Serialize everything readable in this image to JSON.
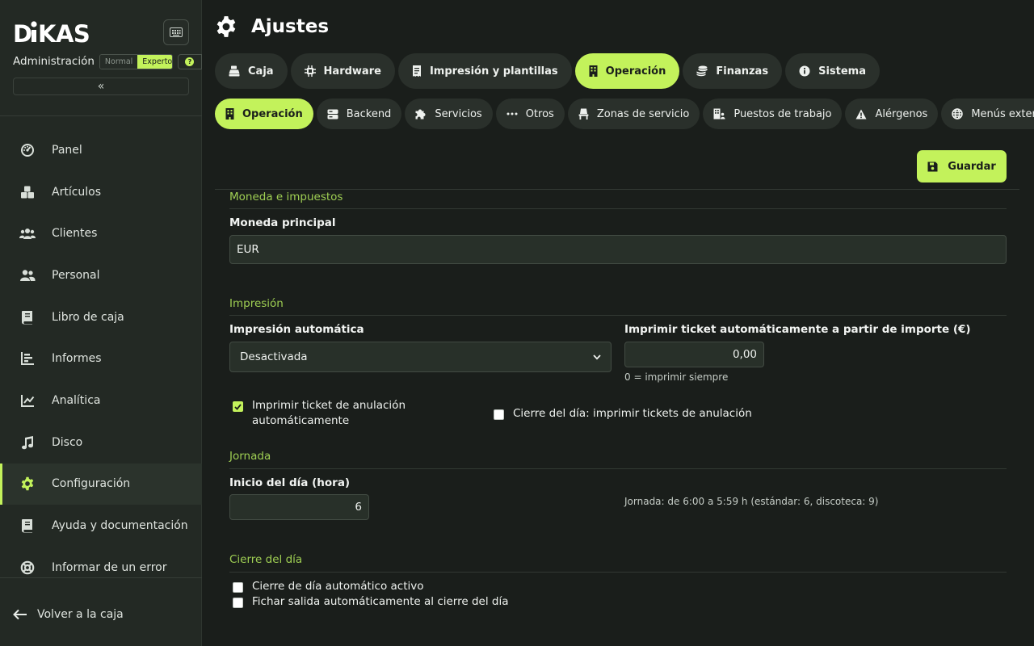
{
  "brand": {
    "logo": "DIKAS"
  },
  "sidebar": {
    "admin_label": "Administración",
    "modes": {
      "normal": "Normal",
      "expert": "Experto",
      "selected": "Experto"
    },
    "help_badge": "?",
    "collapse_glyph": "«",
    "items": [
      {
        "label": "Panel",
        "icon": "dashboard-icon"
      },
      {
        "label": "Artículos",
        "icon": "boxes-icon"
      },
      {
        "label": "Clientes",
        "icon": "users-icon"
      },
      {
        "label": "Personal",
        "icon": "user-group-icon"
      },
      {
        "label": "Libro de caja",
        "icon": "book-icon"
      },
      {
        "label": "Informes",
        "icon": "bar-chart-icon"
      },
      {
        "label": "Analítica",
        "icon": "line-chart-icon"
      },
      {
        "label": "Disco",
        "icon": "music-icon"
      },
      {
        "label": "Configuración",
        "icon": "gear-icon",
        "active": true
      },
      {
        "label": "Ayuda y documentación",
        "icon": "book-icon"
      },
      {
        "label": "Informar de un error",
        "icon": "lifebuoy-icon"
      }
    ],
    "back_label": "Volver a la caja"
  },
  "header": {
    "title": "Ajustes"
  },
  "tabs": [
    {
      "label": "Caja",
      "icon": "register-icon"
    },
    {
      "label": "Hardware",
      "icon": "chip-icon"
    },
    {
      "label": "Impresión y plantillas",
      "icon": "receipt-icon"
    },
    {
      "label": "Operación",
      "icon": "building-icon",
      "active": true
    },
    {
      "label": "Finanzas",
      "icon": "coins-icon"
    },
    {
      "label": "Sistema",
      "icon": "info-icon"
    }
  ],
  "subtabs": [
    {
      "label": "Operación",
      "icon": "building-icon",
      "active": true
    },
    {
      "label": "Backend",
      "icon": "server-icon"
    },
    {
      "label": "Servicios",
      "icon": "puzzle-icon"
    },
    {
      "label": "Otros",
      "icon": "ellipsis-icon"
    },
    {
      "label": "Zonas de servicio",
      "icon": "chair-icon"
    },
    {
      "label": "Puestos de trabajo",
      "icon": "building-user-icon"
    },
    {
      "label": "Alérgenos",
      "icon": "warning-icon"
    },
    {
      "label": "Menús externos",
      "icon": "globe-icon"
    }
  ],
  "actions": {
    "save_label": "Guardar"
  },
  "sections": {
    "currency": {
      "title": "Moneda e impuestos",
      "main_currency_label": "Moneda principal",
      "main_currency_value": "EUR"
    },
    "printing": {
      "title": "Impresión",
      "auto_print_label": "Impresión automática",
      "auto_print_value": "Desactivada",
      "threshold_label": "Imprimir ticket automáticamente a partir de importe (€)",
      "threshold_value": "0,00",
      "threshold_hint": "0 = imprimir siempre",
      "cancel_ticket_label": "Imprimir ticket de anulación automáticamente",
      "cancel_ticket_checked": true,
      "close_day_cancel_label": "Cierre del día: imprimir tickets de anulación",
      "close_day_cancel_checked": false
    },
    "workday": {
      "title": "Jornada",
      "start_label": "Inicio del día (hora)",
      "start_value": "6",
      "hint": "Jornada: de 6:00 a 5:59 h (estándar: 6, discoteca: 9)"
    },
    "day_close": {
      "title": "Cierre del día",
      "auto_close_label": "Cierre de día automático activo",
      "auto_close_checked": false,
      "auto_clockout_label": "Fichar salida automáticamente al cierre del día",
      "auto_clockout_checked": false
    }
  },
  "colors": {
    "accent": "#c3f25b",
    "background": "#1a1e1b",
    "sidebar": "#232924",
    "section_title": "#9fcf53"
  }
}
